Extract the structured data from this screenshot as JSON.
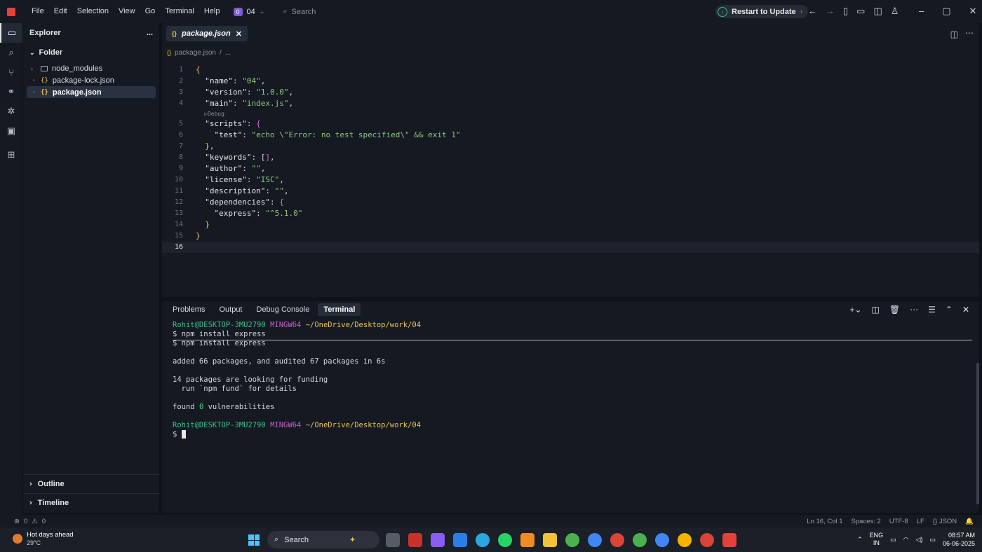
{
  "menu": [
    "File",
    "Edit",
    "Selection",
    "View",
    "Go",
    "Terminal",
    "Help"
  ],
  "project": {
    "badge": "0",
    "name": "04"
  },
  "search_label": "Search",
  "restart_label": "Restart to Update",
  "sidebar": {
    "title": "Explorer",
    "more": "...",
    "folder": "Folder",
    "items": [
      {
        "name": "node_modules",
        "type": "folder"
      },
      {
        "name": "package-lock.json",
        "type": "json"
      },
      {
        "name": "package.json",
        "type": "json",
        "selected": true
      }
    ],
    "outline": "Outline",
    "timeline": "Timeline"
  },
  "editor": {
    "tab_label": "package.json",
    "breadcrumb": [
      "package.json",
      "..."
    ],
    "codelens": "▷Debug",
    "lines": [
      {
        "n": "1",
        "t": "{"
      },
      {
        "n": "2",
        "t": "  \"name\": \"04\","
      },
      {
        "n": "3",
        "t": "  \"version\": \"1.0.0\","
      },
      {
        "n": "4",
        "t": "  \"main\": \"index.js\","
      },
      {
        "n": "5",
        "t": "  \"scripts\": {"
      },
      {
        "n": "6",
        "t": "    \"test\": \"echo \\\"Error: no test specified\\\" && exit 1\""
      },
      {
        "n": "7",
        "t": "  },"
      },
      {
        "n": "8",
        "t": "  \"keywords\": [],"
      },
      {
        "n": "9",
        "t": "  \"author\": \"\","
      },
      {
        "n": "10",
        "t": "  \"license\": \"ISC\","
      },
      {
        "n": "11",
        "t": "  \"description\": \"\","
      },
      {
        "n": "12",
        "t": "  \"dependencies\": {"
      },
      {
        "n": "13",
        "t": "    \"express\": \"^5.1.0\""
      },
      {
        "n": "14",
        "t": "  }"
      },
      {
        "n": "15",
        "t": "}"
      },
      {
        "n": "16",
        "t": ""
      }
    ]
  },
  "panel": {
    "tabs": [
      "Problems",
      "Output",
      "Debug Console",
      "Terminal"
    ],
    "active": "Terminal"
  },
  "terminal": {
    "prompt_user": "Rohit@DESKTOP-3MU2790",
    "prompt_env": "MINGW64",
    "prompt_path": "~/OneDrive/Desktop/work/04",
    "cmd1": "$ npm install express",
    "cmd2": "$ npm install express",
    "added": "added 66 packages, and audited 67 packages in 6s",
    "fund1": "14 packages are looking for funding",
    "fund2": "  run `npm fund` for details",
    "vuln_pre": "found ",
    "vuln_num": "0",
    "vuln_post": " vulnerabilities",
    "prompt_end": "$ "
  },
  "status": {
    "errors": "0",
    "warnings": "0",
    "position": "Ln 16, Col 1",
    "spaces": "Spaces: 2",
    "encoding": "UTF-8",
    "eol": "LF",
    "language": "JSON"
  },
  "taskbar": {
    "weather_title": "Hot days ahead",
    "weather_temp": "29°C",
    "search": "Search",
    "lang1": "ENG",
    "lang2": "IN",
    "time": "08:57 AM",
    "date": "06-06-2025"
  },
  "colors": {
    "accent": "#e5413b",
    "string": "#8ec97c",
    "terminal_user": "#33c48a",
    "terminal_env": "#c85fc8",
    "terminal_path": "#e8c547"
  }
}
